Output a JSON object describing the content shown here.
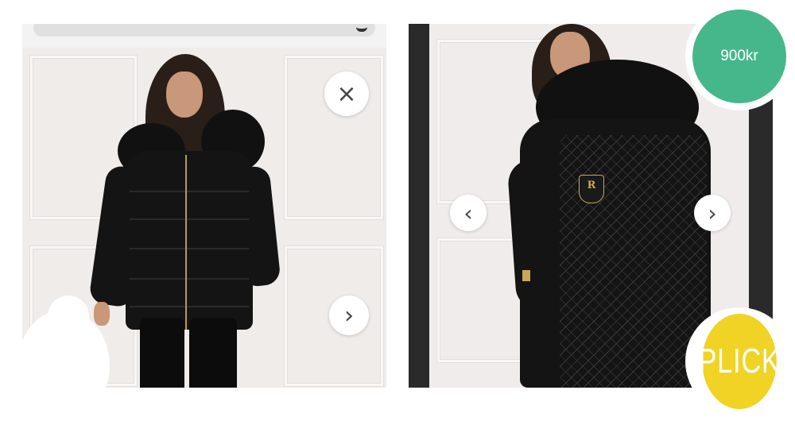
{
  "price_badge": {
    "label": "900kr",
    "color": "#46b78a"
  },
  "plick_button": {
    "label": "PLICK",
    "color": "#f0d324"
  },
  "left_photo": {
    "close_icon": "×",
    "next_icon": "›"
  },
  "right_photo": {
    "prev_icon": "‹",
    "next_icon": "›",
    "badge_letter": "R"
  },
  "icons": [
    "close-icon",
    "chevron-right-icon",
    "chevron-left-icon",
    "search-icon"
  ]
}
